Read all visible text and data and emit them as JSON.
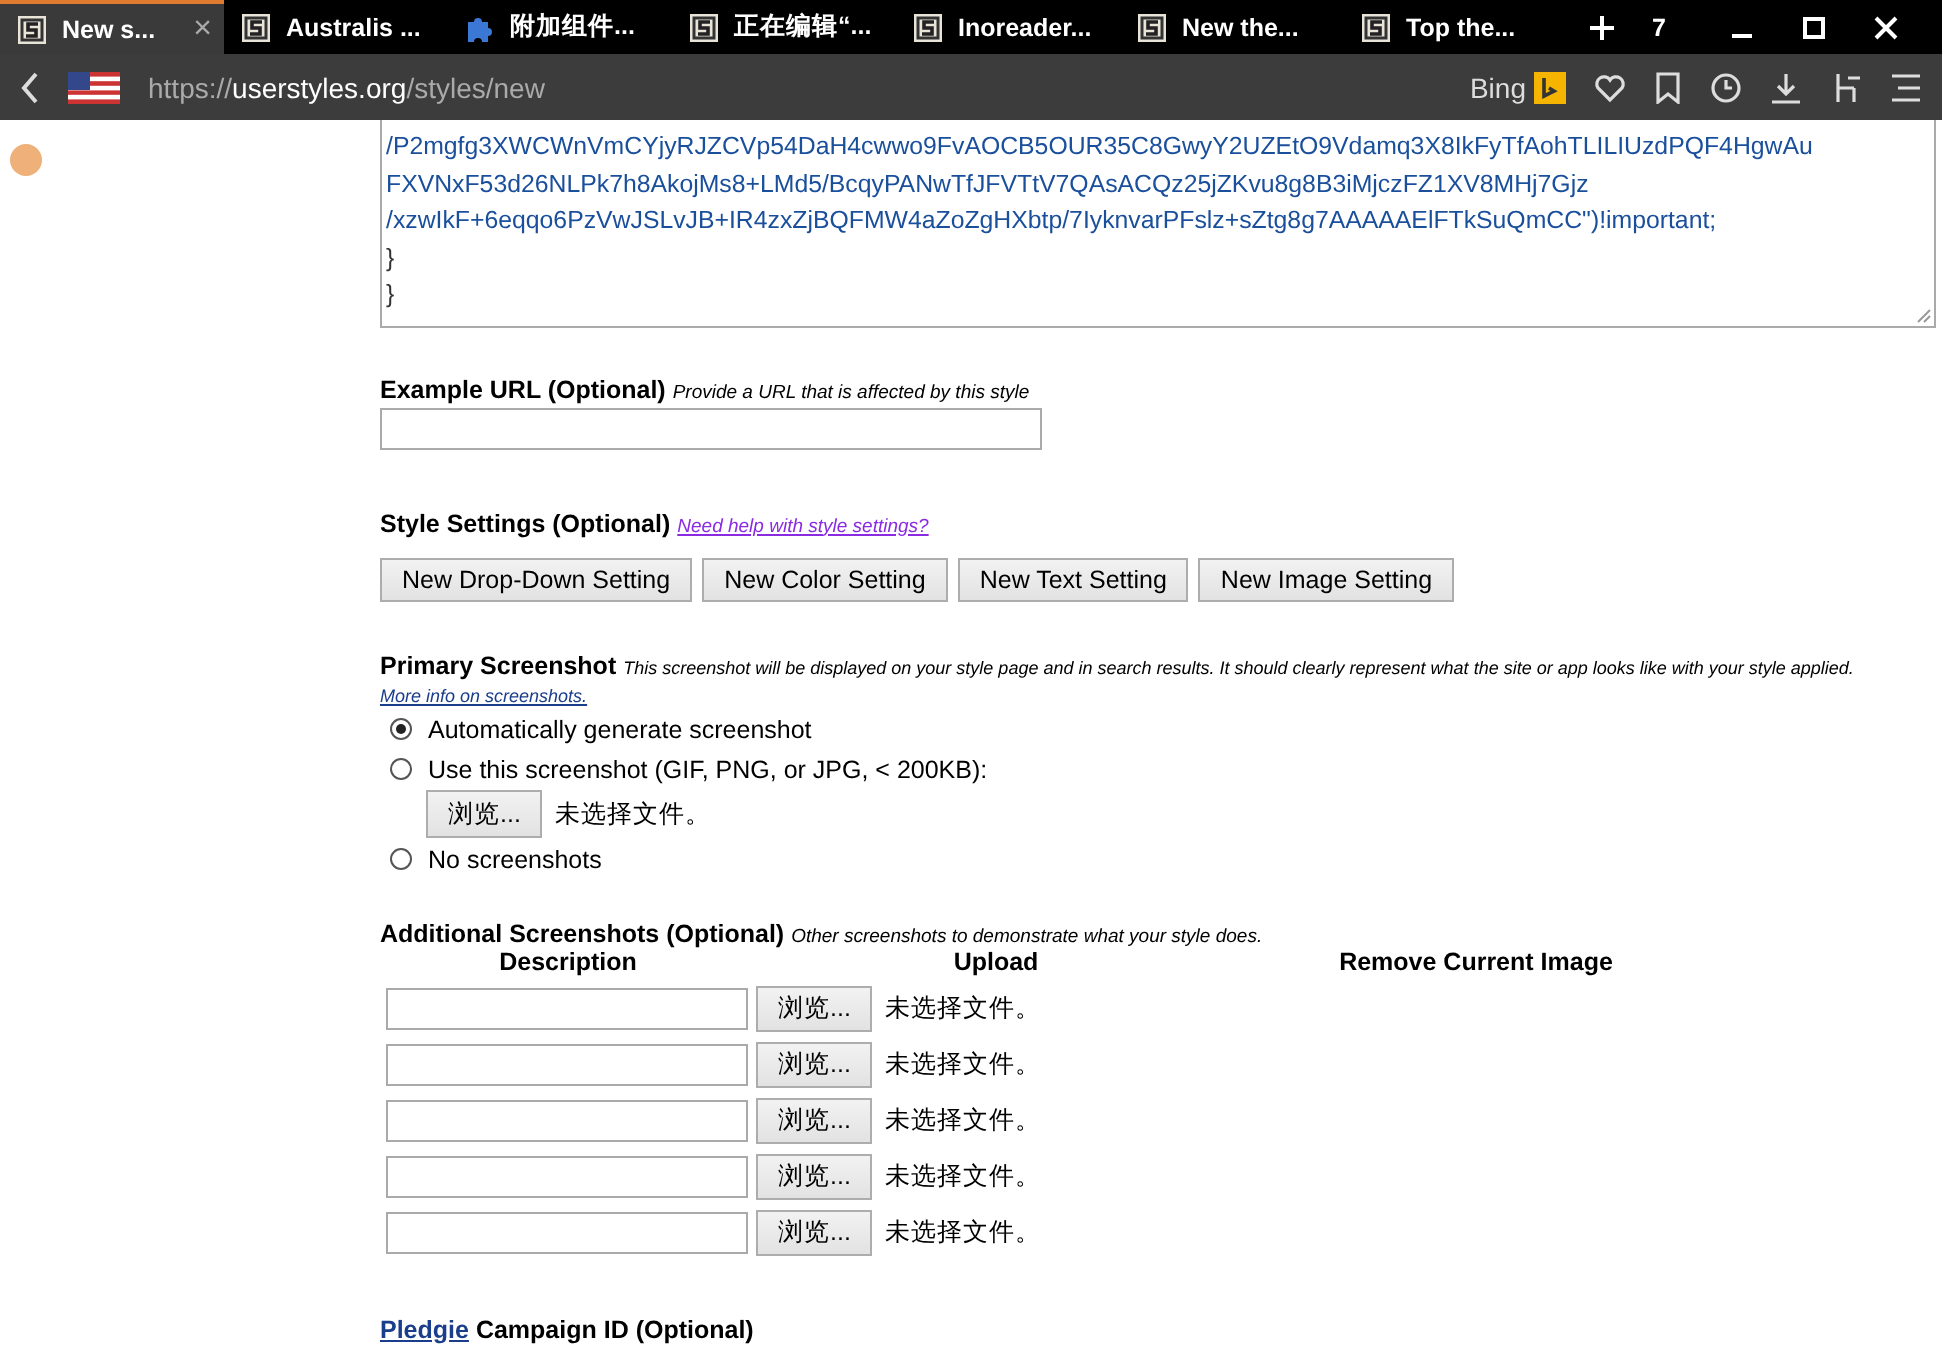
{
  "tabs": [
    {
      "label": "New s...",
      "kind": "site",
      "selected": true,
      "close": "×"
    },
    {
      "label": "Australis ...",
      "kind": "site",
      "selected": false
    },
    {
      "label": "附加组件...",
      "kind": "addon",
      "selected": false
    },
    {
      "label": "正在编辑“...",
      "kind": "site",
      "selected": false
    },
    {
      "label": "Inoreader...",
      "kind": "site",
      "selected": false
    },
    {
      "label": "New the...",
      "kind": "site",
      "selected": false
    },
    {
      "label": "Top the...",
      "kind": "site",
      "selected": false
    }
  ],
  "tab_count": "7",
  "address": {
    "prefix": "https://",
    "host": "userstyles.org",
    "path": "/styles/new"
  },
  "search_engine": "Bing",
  "code_lines": [
    "/P2mgfg3XWCWnVmCYjyRJZCVp54DaH4cwwo9FvAOCB5OUR35C8GwyY2UZEtO9Vdamq3X8IkFyTfAohTLILIUzdPQF4HgwAu",
    "FXVNxF53d26NLPk7h8AkojMs8+LMd5/BcqyPANwTfJFVTtV7QAsACQz25jZKvu8g8B3iMjczFZ1XV8MHj7Gjz",
    "/xzwIkF+6eqqo6PzVwJSLvJB+IR4zxZjBQFMW4aZoZgHXbtp/7IyknvarPFslz+sZtg8g7AAAAAElFTkSuQmCC\")!important;",
    "}",
    "}"
  ],
  "example_url": {
    "label": "Example URL (Optional)",
    "hint": "Provide a URL that is affected by this style"
  },
  "style_settings": {
    "label": "Style Settings (Optional)",
    "help_link": "Need help with style settings?",
    "buttons": [
      "New Drop-Down Setting",
      "New Color Setting",
      "New Text Setting",
      "New Image Setting"
    ]
  },
  "primary_screenshot": {
    "label": "Primary Screenshot",
    "hint": "This screenshot will be displayed on your style page and in search results. It should clearly represent what the site or app looks like with your style applied.",
    "link": "More info on screenshots.",
    "options": [
      {
        "kind": "radio",
        "label": "Automatically generate screenshot",
        "selected": true
      },
      {
        "kind": "radio",
        "label": "Use this screenshot (GIF, PNG, or JPG, < 200KB):",
        "selected": false
      },
      {
        "kind": "file",
        "browse": "浏览...",
        "status": "未选择文件。"
      },
      {
        "kind": "radio",
        "label": "No screenshots",
        "selected": false
      }
    ]
  },
  "additional_screenshots": {
    "label": "Additional Screenshots (Optional)",
    "hint": "Other screenshots to demonstrate what your style does.",
    "columns": [
      "Description",
      "Upload",
      "Remove Current Image"
    ],
    "rows": [
      {
        "browse": "浏览...",
        "status": "未选择文件。"
      },
      {
        "browse": "浏览...",
        "status": "未选择文件。"
      },
      {
        "browse": "浏览...",
        "status": "未选择文件。"
      },
      {
        "browse": "浏览...",
        "status": "未选择文件。"
      },
      {
        "browse": "浏览...",
        "status": "未选择文件。"
      }
    ]
  },
  "pledgie": {
    "link": "Pledgie",
    "label": "Campaign ID (Optional)"
  }
}
